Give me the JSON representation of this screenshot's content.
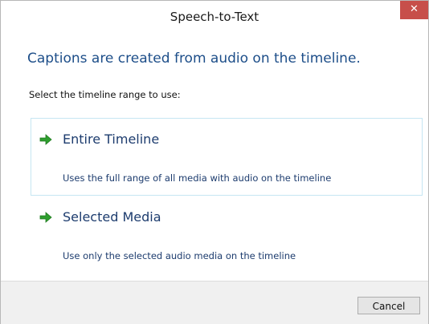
{
  "window": {
    "title": "Speech-to-Text",
    "close_glyph": "✕"
  },
  "main": {
    "heading": "Captions are created from audio on the timeline.",
    "prompt": "Select the timeline range to use:",
    "options": [
      {
        "title": "Entire Timeline",
        "description": "Uses the full range of all media with audio on the timeline",
        "icon": "green-arrow-right-icon",
        "selected": true
      },
      {
        "title": "Selected Media",
        "description": "Use only the selected audio media on the timeline",
        "icon": "green-arrow-right-icon",
        "selected": false
      }
    ]
  },
  "footer": {
    "cancel_label": "Cancel"
  },
  "colors": {
    "close_button": "#c74f4a",
    "heading": "#1d4e89",
    "option_text": "#1d3c6e",
    "arrow": "#2e9e2e",
    "selection_border": "#c6e6f2"
  }
}
